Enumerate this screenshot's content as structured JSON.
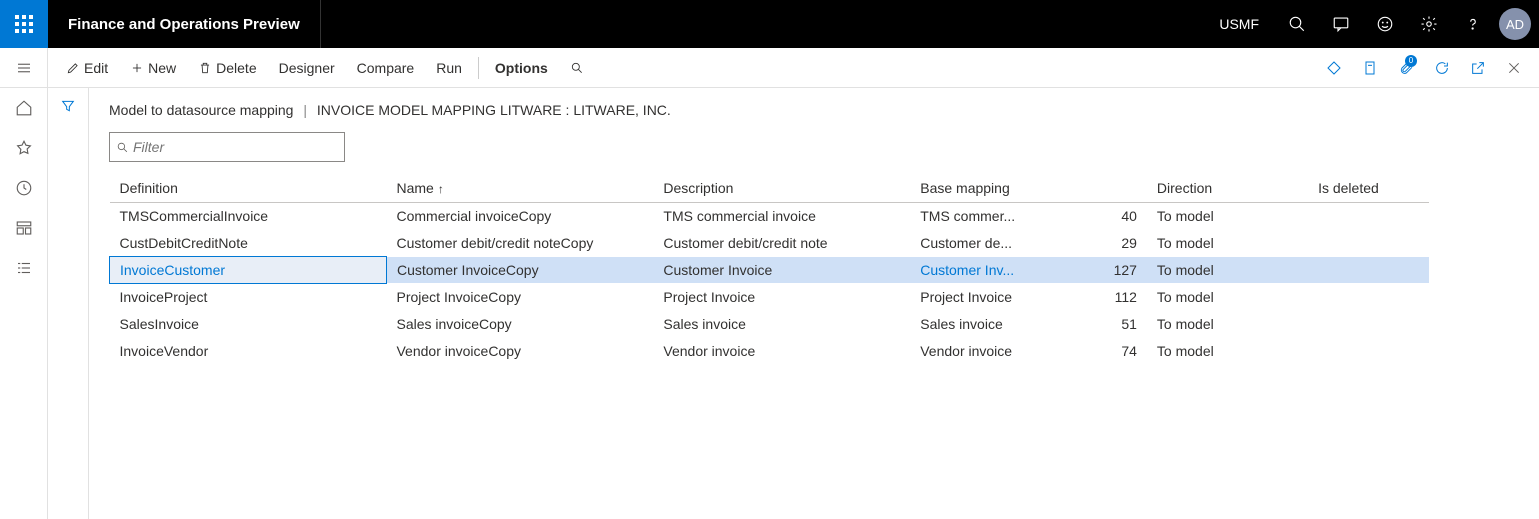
{
  "header": {
    "title": "Finance and Operations Preview",
    "company": "USMF",
    "avatar": "AD"
  },
  "actionbar": {
    "edit": "Edit",
    "new": "New",
    "delete": "Delete",
    "designer": "Designer",
    "compare": "Compare",
    "run": "Run",
    "options": "Options",
    "attachment_badge": "0"
  },
  "breadcrumb": {
    "part1": "Model to datasource mapping",
    "part2": "INVOICE MODEL MAPPING LITWARE : LITWARE, INC."
  },
  "filter": {
    "placeholder": "Filter"
  },
  "columns": {
    "definition": "Definition",
    "name": "Name",
    "description": "Description",
    "base_mapping": "Base mapping",
    "direction": "Direction",
    "is_deleted": "Is deleted"
  },
  "rows": [
    {
      "definition": "TMSCommercialInvoice",
      "name": "Commercial invoiceCopy",
      "description": "TMS commercial invoice",
      "base_mapping": "TMS commer...",
      "count": "40",
      "direction": "To model",
      "is_deleted": "",
      "selected": false
    },
    {
      "definition": "CustDebitCreditNote",
      "name": "Customer debit/credit noteCopy",
      "description": "Customer debit/credit note",
      "base_mapping": "Customer de...",
      "count": "29",
      "direction": "To model",
      "is_deleted": "",
      "selected": false
    },
    {
      "definition": "InvoiceCustomer",
      "name": "Customer InvoiceCopy",
      "description": "Customer Invoice",
      "base_mapping": "Customer Inv...",
      "count": "127",
      "direction": "To model",
      "is_deleted": "",
      "selected": true
    },
    {
      "definition": "InvoiceProject",
      "name": "Project InvoiceCopy",
      "description": "Project Invoice",
      "base_mapping": "Project Invoice",
      "count": "112",
      "direction": "To model",
      "is_deleted": "",
      "selected": false
    },
    {
      "definition": "SalesInvoice",
      "name": "Sales invoiceCopy",
      "description": "Sales invoice",
      "base_mapping": "Sales invoice",
      "count": "51",
      "direction": "To model",
      "is_deleted": "",
      "selected": false
    },
    {
      "definition": "InvoiceVendor",
      "name": "Vendor invoiceCopy",
      "description": "Vendor invoice",
      "base_mapping": "Vendor invoice",
      "count": "74",
      "direction": "To model",
      "is_deleted": "",
      "selected": false
    }
  ]
}
